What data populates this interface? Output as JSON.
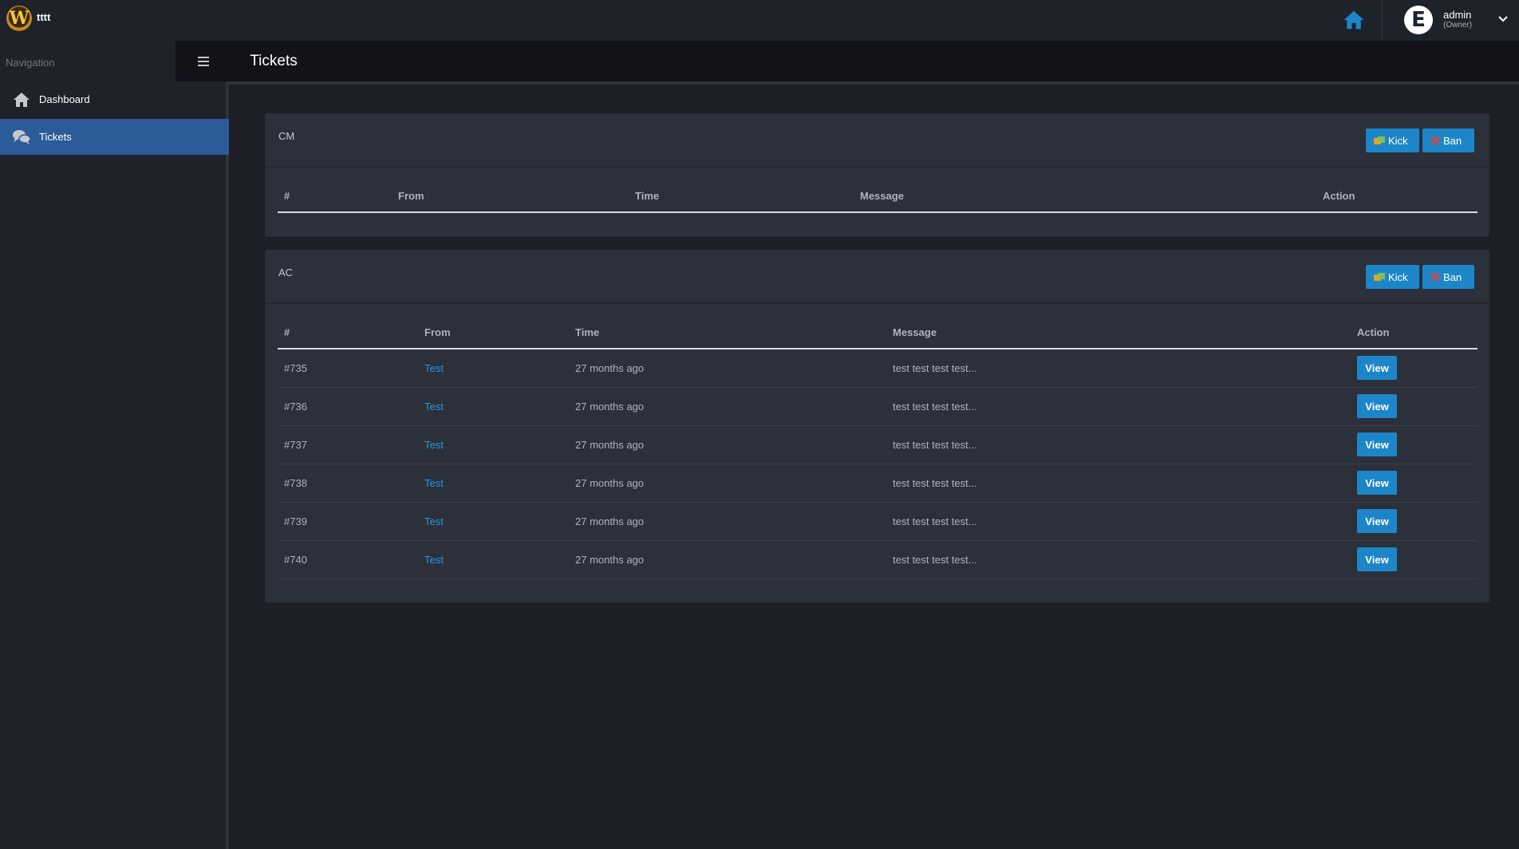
{
  "app": {
    "title": "tttt",
    "logo_letter": "W"
  },
  "user": {
    "avatar_letter": "E",
    "name": "admin",
    "role": "(Owner)"
  },
  "sidebar": {
    "heading": "Navigation",
    "items": [
      {
        "label": "Dashboard",
        "icon": "home-icon",
        "active": false
      },
      {
        "label": "Tickets",
        "icon": "chat-icon",
        "active": true
      }
    ]
  },
  "header": {
    "tab": "Tickets"
  },
  "colors": {
    "accent": "#1d86c9",
    "active_nav": "#2b5b98",
    "link": "#2c96df",
    "ban_x": "#e8413d",
    "kick_icon": "#e0a524"
  },
  "panels": [
    {
      "title": "CM",
      "kick_label": "Kick",
      "ban_label": "Ban",
      "columns": [
        "#",
        "From",
        "Time",
        "Message",
        "Action"
      ],
      "rows": []
    },
    {
      "title": "AC",
      "kick_label": "Kick",
      "ban_label": "Ban",
      "columns": [
        "#",
        "From",
        "Time",
        "Message",
        "Action"
      ],
      "rows": [
        {
          "id": "#735",
          "from": "Test",
          "time": "27 months ago",
          "message": "test test test test...",
          "action": "View"
        },
        {
          "id": "#736",
          "from": "Test",
          "time": "27 months ago",
          "message": "test test test test...",
          "action": "View"
        },
        {
          "id": "#737",
          "from": "Test",
          "time": "27 months ago",
          "message": "test test test test...",
          "action": "View"
        },
        {
          "id": "#738",
          "from": "Test",
          "time": "27 months ago",
          "message": "test test test test...",
          "action": "View"
        },
        {
          "id": "#739",
          "from": "Test",
          "time": "27 months ago",
          "message": "test test test test...",
          "action": "View"
        },
        {
          "id": "#740",
          "from": "Test",
          "time": "27 months ago",
          "message": "test test test test...",
          "action": "View"
        }
      ]
    }
  ]
}
